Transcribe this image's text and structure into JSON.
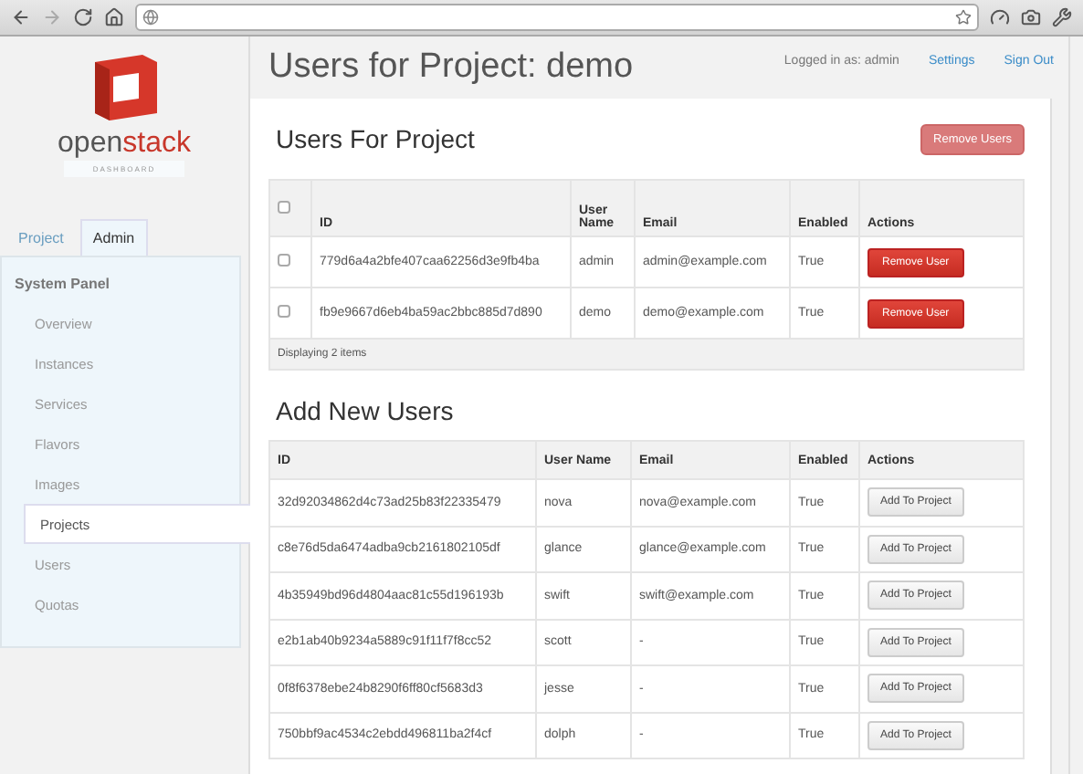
{
  "sidebar": {
    "logo": {
      "wordmark": [
        "open",
        "stack"
      ],
      "subtitle": "DASHBOARD"
    },
    "tabs": [
      {
        "label": "Project",
        "selected": false
      },
      {
        "label": "Admin",
        "selected": true
      }
    ],
    "panel_title": "System Panel",
    "items": [
      {
        "label": "Overview",
        "selected": false
      },
      {
        "label": "Instances",
        "selected": false
      },
      {
        "label": "Services",
        "selected": false
      },
      {
        "label": "Flavors",
        "selected": false
      },
      {
        "label": "Images",
        "selected": false
      },
      {
        "label": "Projects",
        "selected": true
      },
      {
        "label": "Users",
        "selected": false
      },
      {
        "label": "Quotas",
        "selected": false
      }
    ]
  },
  "header": {
    "title": "Users for Project: demo",
    "logged_in": "Logged in as: admin",
    "links": [
      "Settings",
      "Sign Out"
    ]
  },
  "project_users": {
    "title": "Users For Project",
    "button": "Remove Users",
    "select_all_checked": false,
    "columns": [
      "ID",
      "User Name",
      "Email",
      "Enabled",
      "Actions"
    ],
    "rows": [
      {
        "checked": false,
        "id": "779d6a4a2bfe407caa62256d3e9fb4ba",
        "name": "admin",
        "email": "admin@example.com",
        "enabled": "True",
        "action": "Remove User"
      },
      {
        "checked": false,
        "id": "fb9e9667d6eb4ba59ac2bbc885d7d890",
        "name": "demo",
        "email": "demo@example.com",
        "enabled": "True",
        "action": "Remove User"
      }
    ],
    "footer": "Displaying 2 items"
  },
  "new_users": {
    "title": "Add New Users",
    "columns": [
      "ID",
      "User Name",
      "Email",
      "Enabled",
      "Actions"
    ],
    "rows": [
      {
        "id": "32d92034862d4c73ad25b83f22335479",
        "name": "nova",
        "email": "nova@example.com",
        "enabled": "True",
        "action": "Add To Project"
      },
      {
        "id": "c8e76d5da6474adba9cb2161802105df",
        "name": "glance",
        "email": "glance@example.com",
        "enabled": "True",
        "action": "Add To Project"
      },
      {
        "id": "4b35949bd96d4804aac81c55d196193b",
        "name": "swift",
        "email": "swift@example.com",
        "enabled": "True",
        "action": "Add To Project"
      },
      {
        "id": "e2b1ab40b9234a5889c91f11f7f8cc52",
        "name": "scott",
        "email": "-",
        "enabled": "True",
        "action": "Add To Project"
      },
      {
        "id": "0f8f6378ebe24b8290f6ff80cf5683d3",
        "name": "jesse",
        "email": "-",
        "enabled": "True",
        "action": "Add To Project"
      },
      {
        "id": "750bbf9ac4534c2ebdd496811ba2f4cf",
        "name": "dolph",
        "email": "-",
        "enabled": "True",
        "action": "Add To Project"
      }
    ]
  }
}
